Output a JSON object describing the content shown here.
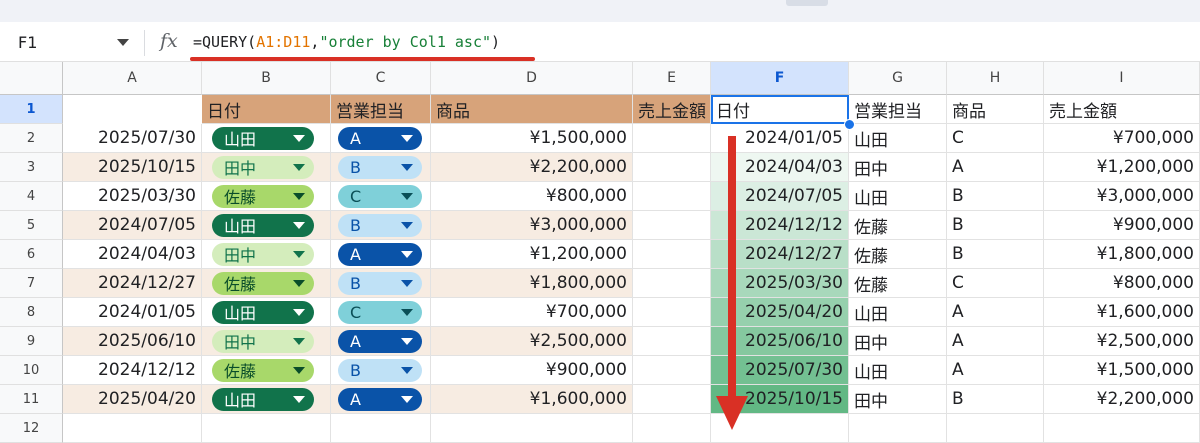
{
  "namebox": "F1",
  "formula": {
    "prefix": "=QUERY(",
    "range": "A1:D11",
    "comma": ",",
    "query": "\"order by Col1 asc\"",
    "suffix": ")"
  },
  "columns": [
    "A",
    "B",
    "C",
    "D",
    "E",
    "F",
    "G",
    "H",
    "I"
  ],
  "rows": [
    "1",
    "2",
    "3",
    "4",
    "5",
    "6",
    "7",
    "8",
    "9",
    "10",
    "11",
    "12"
  ],
  "selected_column": "F",
  "selected_row": "1",
  "headers": [
    "日付",
    "営業担当",
    "商品",
    "売上金額"
  ],
  "source_rows": [
    {
      "date": "2025/07/30",
      "person": "山田",
      "product": "A",
      "amount": "¥1,500,000"
    },
    {
      "date": "2025/10/15",
      "person": "田中",
      "product": "B",
      "amount": "¥2,200,000"
    },
    {
      "date": "2025/03/30",
      "person": "佐藤",
      "product": "C",
      "amount": "¥800,000"
    },
    {
      "date": "2024/07/05",
      "person": "山田",
      "product": "B",
      "amount": "¥3,000,000"
    },
    {
      "date": "2024/04/03",
      "person": "田中",
      "product": "A",
      "amount": "¥1,200,000"
    },
    {
      "date": "2024/12/27",
      "person": "佐藤",
      "product": "B",
      "amount": "¥1,800,000"
    },
    {
      "date": "2024/01/05",
      "person": "山田",
      "product": "C",
      "amount": "¥700,000"
    },
    {
      "date": "2025/06/10",
      "person": "田中",
      "product": "A",
      "amount": "¥2,500,000"
    },
    {
      "date": "2024/12/12",
      "person": "佐藤",
      "product": "B",
      "amount": "¥900,000"
    },
    {
      "date": "2025/04/20",
      "person": "山田",
      "product": "A",
      "amount": "¥1,600,000"
    }
  ],
  "result_rows": [
    {
      "date": "2024/01/05",
      "person": "山田",
      "product": "C",
      "amount": "¥700,000"
    },
    {
      "date": "2024/04/03",
      "person": "田中",
      "product": "A",
      "amount": "¥1,200,000"
    },
    {
      "date": "2024/07/05",
      "person": "山田",
      "product": "B",
      "amount": "¥3,000,000"
    },
    {
      "date": "2024/12/12",
      "person": "佐藤",
      "product": "B",
      "amount": "¥900,000"
    },
    {
      "date": "2024/12/27",
      "person": "佐藤",
      "product": "B",
      "amount": "¥1,800,000"
    },
    {
      "date": "2025/03/30",
      "person": "佐藤",
      "product": "C",
      "amount": "¥800,000"
    },
    {
      "date": "2025/04/20",
      "person": "山田",
      "product": "A",
      "amount": "¥1,600,000"
    },
    {
      "date": "2025/06/10",
      "person": "田中",
      "product": "A",
      "amount": "¥2,500,000"
    },
    {
      "date": "2025/07/30",
      "person": "山田",
      "product": "A",
      "amount": "¥1,500,000"
    },
    {
      "date": "2025/10/15",
      "person": "田中",
      "product": "B",
      "amount": "¥2,200,000"
    }
  ],
  "chip_colors": {
    "山田": {
      "bg": "#11734b",
      "fg": "#ffffff"
    },
    "田中": {
      "bg": "#d4edbc",
      "fg": "#11734b"
    },
    "佐藤": {
      "bg": "#a8d86a",
      "fg": "#0a4d2a"
    },
    "A": {
      "bg": "#0a53a8",
      "fg": "#ffffff"
    },
    "B": {
      "bg": "#bfe1f6",
      "fg": "#0a53a8"
    },
    "C": {
      "bg": "#7fd0d9",
      "fg": "#0a4f57"
    }
  },
  "gradient_colors": [
    "#ffffff",
    "#62b884"
  ],
  "accent": "#1a73e8",
  "arrow_color": "#d93025"
}
